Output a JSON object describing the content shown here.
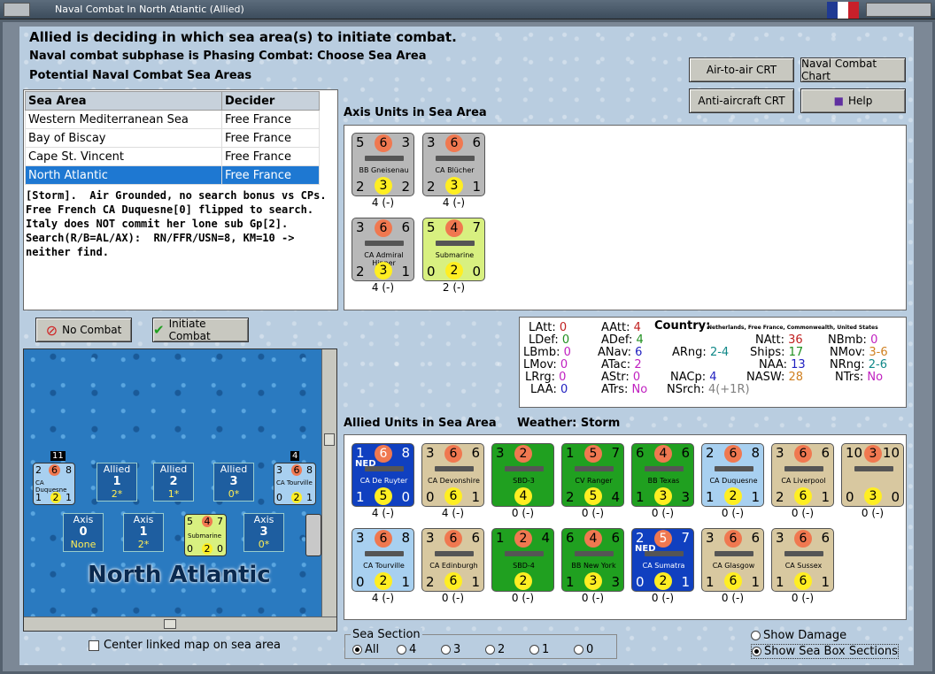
{
  "window": {
    "title": "Naval Combat In North Atlantic (Allied)"
  },
  "header": {
    "line1": "Allied is deciding in which sea area(s) to initiate combat.",
    "line2": "Naval combat subphase is Phasing Combat: Choose Sea Area",
    "line3": "Potential Naval Combat Sea Areas"
  },
  "buttons": {
    "air_to_air": "Air-to-air CRT",
    "naval_chart": "Naval Combat Chart",
    "anti_aircraft": "Anti-aircraft CRT",
    "help": "Help",
    "no_combat": "No Combat",
    "initiate": "Initiate Combat"
  },
  "sea_table": {
    "headers": [
      "Sea Area",
      "Decider"
    ],
    "rows": [
      [
        "Western Mediterranean Sea",
        "Free France"
      ],
      [
        "Bay of Biscay",
        "Free France"
      ],
      [
        "Cape St. Vincent",
        "Free France"
      ],
      [
        "North Atlantic",
        "Free France"
      ]
    ]
  },
  "notes": "[Storm].  Air Grounded, no search bonus vs CPs.\nFree French CA Duquesne[0] flipped to search.\nItaly does NOT commit her lone sub Gp[2].\nSearch(R/B=AL/AX):  RN/FFR/USN=8, KM=10 ->\nneither find.",
  "axis_label": "Axis Units in Sea Area",
  "axis_units": [
    {
      "l": "5",
      "m": "6",
      "r": "3",
      "name": "BB Gneisenau",
      "bl": "2",
      "bm": "3",
      "br": "2",
      "stack": "4 (-)",
      "color": "#b8b8b8"
    },
    {
      "l": "3",
      "m": "6",
      "r": "6",
      "name": "CA Blücher",
      "bl": "2",
      "bm": "3",
      "br": "1",
      "stack": "4 (-)",
      "color": "#b8b8b8"
    },
    {
      "l": "3",
      "m": "6",
      "r": "6",
      "name": "CA Admiral Hipper",
      "bl": "2",
      "bm": "3",
      "br": "1",
      "stack": "4 (-)",
      "color": "#b8b8b8"
    },
    {
      "l": "5",
      "m": "4",
      "r": "7",
      "name": "Submarine",
      "bl": "0",
      "bm": "2",
      "br": "0",
      "stack": "2 (-)",
      "color": "#d8f080"
    }
  ],
  "allied_label": "Allied Units in Sea Area",
  "weather": "Weather:  Storm",
  "allied_units": [
    {
      "l": "1",
      "m": "6",
      "r": "8",
      "tag": "NED",
      "name": "CA De Ruyter",
      "bl": "1",
      "bm": "5",
      "br": "0",
      "stack": "4 (-)",
      "color": "#1040c0",
      "fg": "#fff"
    },
    {
      "l": "3",
      "m": "6",
      "r": "6",
      "name": "CA Devonshire",
      "bl": "0",
      "bm": "6",
      "br": "1",
      "stack": "4 (-)",
      "color": "#d8c8a0"
    },
    {
      "l": "3",
      "m": "2",
      "r": "",
      "name": "SBD-3",
      "bl": "",
      "bm": "4",
      "br": "",
      "stack": "0 (-)",
      "color": "#20a020"
    },
    {
      "l": "1",
      "m": "5",
      "r": "7",
      "name": "CV Ranger",
      "bl": "2",
      "bm": "5",
      "br": "4",
      "stack": "0 (-)",
      "color": "#20a020"
    },
    {
      "l": "6",
      "m": "4",
      "r": "6",
      "name": "BB Texas",
      "bl": "1",
      "bm": "3",
      "br": "3",
      "stack": "0 (-)",
      "color": "#20a020"
    },
    {
      "l": "2",
      "m": "6",
      "r": "8",
      "name": "CA Duquesne",
      "bl": "1",
      "bm": "2",
      "br": "1",
      "stack": "0 (-)",
      "color": "#a8d0f0"
    },
    {
      "l": "3",
      "m": "6",
      "r": "6",
      "name": "CA Liverpool",
      "bl": "2",
      "bm": "6",
      "br": "1",
      "stack": "0 (-)",
      "color": "#d8c8a0"
    },
    {
      "l": "10",
      "m": "3",
      "r": "10",
      "name": "",
      "bl": "0",
      "bm": "3",
      "br": "0",
      "stack": "0 (-)",
      "color": "#d8c8a0"
    },
    {
      "l": "3",
      "m": "6",
      "r": "8",
      "name": "CA Tourville",
      "bl": "0",
      "bm": "2",
      "br": "1",
      "stack": "4 (-)",
      "color": "#a8d0f0"
    },
    {
      "l": "3",
      "m": "6",
      "r": "6",
      "name": "CA Edinburgh",
      "bl": "2",
      "bm": "6",
      "br": "1",
      "stack": "0 (-)",
      "color": "#d8c8a0"
    },
    {
      "l": "1",
      "m": "2",
      "r": "4",
      "name": "SBD-4",
      "bl": "",
      "bm": "2",
      "br": "",
      "stack": "0 (-)",
      "color": "#20a020"
    },
    {
      "l": "6",
      "m": "4",
      "r": "6",
      "name": "BB New York",
      "bl": "1",
      "bm": "3",
      "br": "3",
      "stack": "0 (-)",
      "color": "#20a020"
    },
    {
      "l": "2",
      "m": "5",
      "r": "7",
      "tag": "NED",
      "name": "CA Sumatra",
      "bl": "0",
      "bm": "2",
      "br": "1",
      "stack": "0 (-)",
      "color": "#1040c0",
      "fg": "#fff"
    },
    {
      "l": "3",
      "m": "6",
      "r": "6",
      "name": "CA Glasgow",
      "bl": "1",
      "bm": "6",
      "br": "1",
      "stack": "0 (-)",
      "color": "#d8c8a0"
    },
    {
      "l": "3",
      "m": "6",
      "r": "6",
      "name": "CA Sussex",
      "bl": "1",
      "bm": "6",
      "br": "1",
      "stack": "0 (-)",
      "color": "#d8c8a0"
    }
  ],
  "stats": {
    "country_label": "Country:",
    "country": "Netherlands, Free France, Commonwealth, United States",
    "LAtt": "0",
    "LDef": "0",
    "LBmb": "0",
    "LMov": "0",
    "LRrg": "0",
    "LAA": "0",
    "AAtt": "4",
    "ADef": "4",
    "ANav": "6",
    "ATac": "2",
    "AStr": "0",
    "ATrs": "No",
    "ARng": "2-4",
    "NACp": "4",
    "NSrch": "4(+1R)",
    "NAtt": "36",
    "Ships": "17",
    "NAA": "13",
    "NASW": "28",
    "NBmb": "0",
    "NMov": "3-6",
    "NRng": "2-6",
    "NTrs": "No"
  },
  "map": {
    "title": "North Atlantic",
    "allied_boxes": [
      {
        "h": "Allied",
        "n": "1",
        "v": "2*"
      },
      {
        "h": "Allied",
        "n": "2",
        "v": "1*"
      },
      {
        "h": "Allied",
        "n": "3",
        "v": "0*"
      }
    ],
    "axis_boxes": [
      {
        "h": "Axis",
        "n": "0",
        "v": "None"
      },
      {
        "h": "Axis",
        "n": "1",
        "v": "2*"
      },
      {
        "h": "Axis",
        "n": "3",
        "v": "0*"
      }
    ],
    "stack_a": "11",
    "stack_b": "4",
    "unit_a": "CA Duquesne",
    "unit_b": "CA Tourville",
    "unit_c": "Submarine"
  },
  "center_map_label": "Center linked map on sea area",
  "sea_section": {
    "label": "Sea Section",
    "options": [
      "All",
      "4",
      "3",
      "2",
      "1",
      "0"
    ]
  },
  "show_damage": "Show Damage",
  "show_sections": "Show Sea Box Sections"
}
